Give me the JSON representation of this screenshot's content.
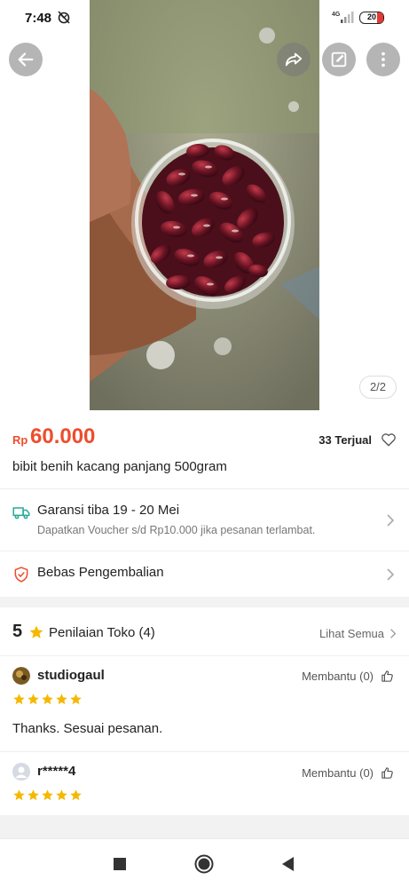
{
  "status": {
    "time": "7:48",
    "network": "4G",
    "battery": "20"
  },
  "gallery": {
    "counter": "2/2",
    "icons": [
      "back-arrow-icon",
      "share-icon",
      "edit-icon",
      "more-vert-icon"
    ]
  },
  "product": {
    "currency": "Rp",
    "price": "60.000",
    "sold": "33 Terjual",
    "title": "bibit benih kacang panjang 500gram"
  },
  "shipping": {
    "title": "Garansi tiba 19 - 20 Mei",
    "subtitle": "Dapatkan Voucher s/d Rp10.000 jika pesanan terlambat."
  },
  "returns": {
    "title": "Bebas Pengembalian"
  },
  "ratings": {
    "score": "5",
    "label": "Penilaian Toko (4)",
    "see_all": "Lihat Semua",
    "reviews": [
      {
        "name": "studiogaul",
        "helpful": "Membantu (0)",
        "stars": 5,
        "text": "Thanks. Sesuai pesanan."
      },
      {
        "name": "r*****4",
        "helpful": "Membantu (0)",
        "stars": 5,
        "text": ""
      }
    ]
  },
  "colors": {
    "accent": "#ee4d2d",
    "star": "#f5b800",
    "teal": "#26aa99"
  }
}
